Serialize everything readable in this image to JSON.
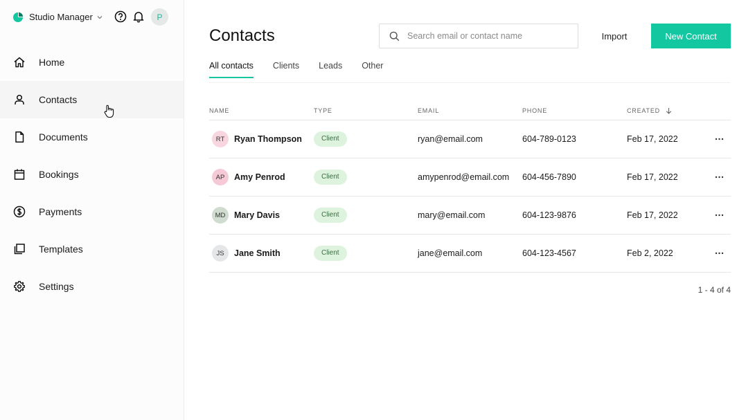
{
  "app": {
    "brand": "Studio Manager",
    "avatar_initial": "P",
    "accent": "#13c8a1"
  },
  "sidebar": {
    "items": [
      {
        "label": "Home",
        "icon": "home-icon"
      },
      {
        "label": "Contacts",
        "icon": "user-icon",
        "active": true
      },
      {
        "label": "Documents",
        "icon": "document-icon"
      },
      {
        "label": "Bookings",
        "icon": "calendar-icon"
      },
      {
        "label": "Payments",
        "icon": "dollar-icon"
      },
      {
        "label": "Templates",
        "icon": "templates-icon"
      },
      {
        "label": "Settings",
        "icon": "gear-icon"
      }
    ]
  },
  "header": {
    "title": "Contacts",
    "search_placeholder": "Search email or contact name",
    "import_label": "Import",
    "new_contact_label": "New Contact"
  },
  "tabs": [
    {
      "label": "All contacts",
      "active": true
    },
    {
      "label": "Clients"
    },
    {
      "label": "Leads"
    },
    {
      "label": "Other"
    }
  ],
  "table": {
    "columns": [
      "NAME",
      "TYPE",
      "EMAIL",
      "PHONE",
      "CREATED"
    ],
    "sort_column": "CREATED",
    "rows": [
      {
        "initials": "RT",
        "avatar_color": "#f7d6e0",
        "name": "Ryan Thompson",
        "type": "Client",
        "email": "ryan@email.com",
        "phone": "604-789-0123",
        "created": "Feb 17, 2022"
      },
      {
        "initials": "AP",
        "avatar_color": "#f6c9d6",
        "name": "Amy Penrod",
        "type": "Client",
        "email": "amypenrod@email.com",
        "phone": "604-456-7890",
        "created": "Feb 17, 2022"
      },
      {
        "initials": "MD",
        "avatar_color": "#cfdccf",
        "name": "Mary Davis",
        "type": "Client",
        "email": "mary@email.com",
        "phone": "604-123-9876",
        "created": "Feb 17, 2022"
      },
      {
        "initials": "JS",
        "avatar_color": "#e4e6e8",
        "name": "Jane Smith",
        "type": "Client",
        "email": "jane@email.com",
        "phone": "604-123-4567",
        "created": "Feb 2, 2022"
      }
    ]
  },
  "pagination": "1 - 4 of 4"
}
